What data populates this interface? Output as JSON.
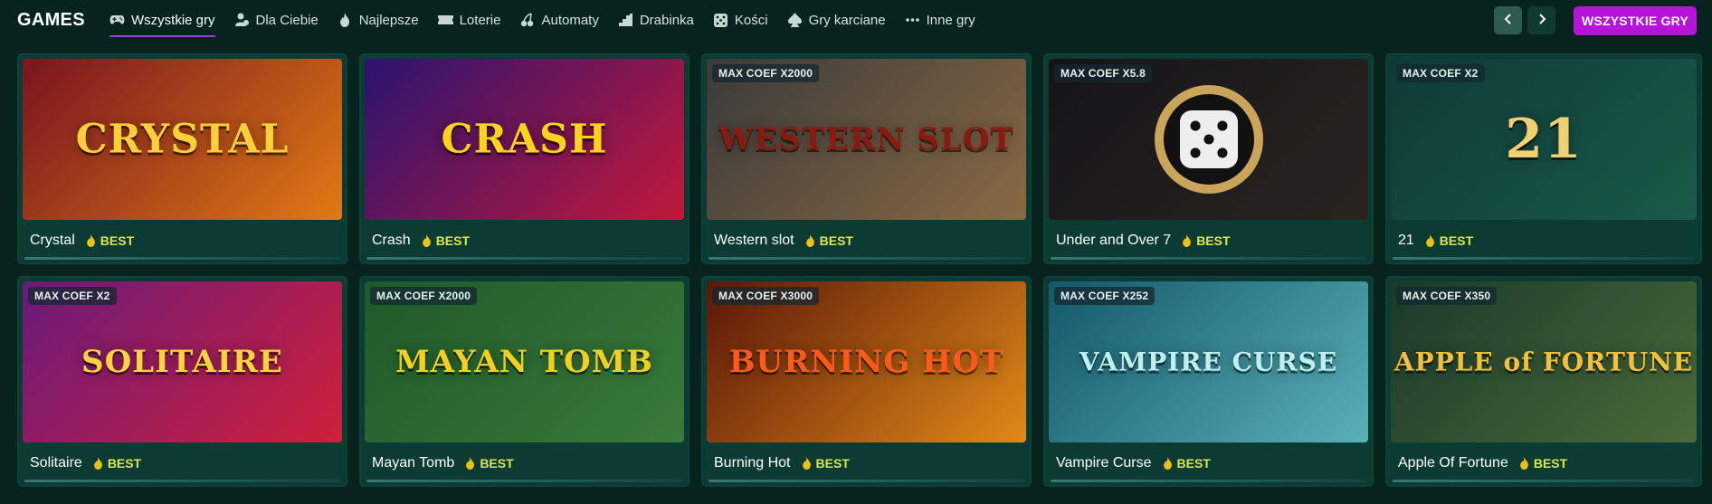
{
  "brand": "GAMES",
  "nav": [
    {
      "label": "Wszystkie gry",
      "icon": "gamepad-icon",
      "active": true
    },
    {
      "label": "Dla Ciebie",
      "icon": "user-icon",
      "active": false
    },
    {
      "label": "Najlepsze",
      "icon": "fire-icon",
      "active": false
    },
    {
      "label": "Loterie",
      "icon": "ticket-icon",
      "active": false
    },
    {
      "label": "Automaty",
      "icon": "cherries-icon",
      "active": false
    },
    {
      "label": "Drabinka",
      "icon": "stairs-icon",
      "active": false
    },
    {
      "label": "Kości",
      "icon": "dice-icon",
      "active": false
    },
    {
      "label": "Gry karciane",
      "icon": "spade-icon",
      "active": false
    },
    {
      "label": "Inne gry",
      "icon": "dots-icon",
      "active": false
    }
  ],
  "controls": {
    "prev_icon": "chevron-left-icon",
    "next_icon": "chevron-right-icon",
    "all_games_label": "WSZYSTKIE GRY"
  },
  "games": [
    {
      "name": "Crystal",
      "badge": "BEST",
      "coef": "",
      "art_title": "CRYSTAL",
      "colors": [
        "#7a1420",
        "#e07a14"
      ],
      "title_color": "#ffce3a"
    },
    {
      "name": "Crash",
      "badge": "BEST",
      "coef": "",
      "art_title": "CRASH",
      "colors": [
        "#2a1470",
        "#c2183a"
      ],
      "title_color": "#ffd21e"
    },
    {
      "name": "Western slot",
      "badge": "BEST",
      "coef": "MAX COEF X2000",
      "art_title": "WESTERN SLOT",
      "colors": [
        "#3a3a3a",
        "#8a6a44"
      ],
      "title_color": "#8a1a10"
    },
    {
      "name": "Under and Over 7",
      "badge": "BEST",
      "coef": "MAX COEF X5.8",
      "art_title": "",
      "colors": [
        "#141418",
        "#2a2420"
      ],
      "title_color": "#d8b060"
    },
    {
      "name": "21",
      "badge": "BEST",
      "coef": "MAX COEF X2",
      "art_title": "21",
      "colors": [
        "#0e3a36",
        "#1a5a4a"
      ],
      "title_color": "#f0d070"
    },
    {
      "name": "Solitaire",
      "badge": "BEST",
      "coef": "MAX COEF X2",
      "art_title": "SOLITAIRE",
      "colors": [
        "#6a1a7a",
        "#d0203a"
      ],
      "title_color": "#ffd240"
    },
    {
      "name": "Mayan Tomb",
      "badge": "BEST",
      "coef": "MAX COEF X2000",
      "art_title": "MAYAN TOMB",
      "colors": [
        "#1e5a2a",
        "#3a7a3a"
      ],
      "title_color": "#f0d020"
    },
    {
      "name": "Burning Hot",
      "badge": "BEST",
      "coef": "MAX COEF X3000",
      "art_title": "BURNING HOT",
      "colors": [
        "#5a1608",
        "#e08a18"
      ],
      "title_color": "#ff5a1a"
    },
    {
      "name": "Vampire Curse",
      "badge": "BEST",
      "coef": "MAX COEF X252",
      "art_title": "VAMPIRE CURSE",
      "colors": [
        "#12586a",
        "#5ab0b8"
      ],
      "title_color": "#bff0f0"
    },
    {
      "name": "Apple Of Fortune",
      "badge": "BEST",
      "coef": "MAX COEF X350",
      "art_title": "APPLE of FORTUNE",
      "colors": [
        "#1a3a2a",
        "#4a6a3a"
      ],
      "title_color": "#f0c040"
    }
  ]
}
